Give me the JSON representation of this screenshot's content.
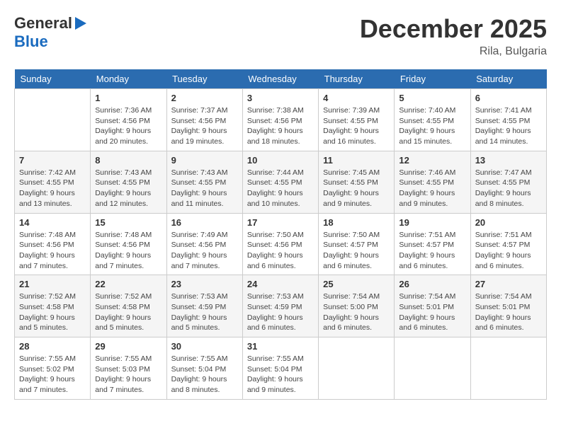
{
  "header": {
    "logo_line1": "General",
    "logo_line2": "Blue",
    "month_year": "December 2025",
    "location": "Rila, Bulgaria"
  },
  "days_of_week": [
    "Sunday",
    "Monday",
    "Tuesday",
    "Wednesday",
    "Thursday",
    "Friday",
    "Saturday"
  ],
  "weeks": [
    [
      {
        "day": "",
        "info": ""
      },
      {
        "day": "1",
        "info": "Sunrise: 7:36 AM\nSunset: 4:56 PM\nDaylight: 9 hours\nand 20 minutes."
      },
      {
        "day": "2",
        "info": "Sunrise: 7:37 AM\nSunset: 4:56 PM\nDaylight: 9 hours\nand 19 minutes."
      },
      {
        "day": "3",
        "info": "Sunrise: 7:38 AM\nSunset: 4:56 PM\nDaylight: 9 hours\nand 18 minutes."
      },
      {
        "day": "4",
        "info": "Sunrise: 7:39 AM\nSunset: 4:55 PM\nDaylight: 9 hours\nand 16 minutes."
      },
      {
        "day": "5",
        "info": "Sunrise: 7:40 AM\nSunset: 4:55 PM\nDaylight: 9 hours\nand 15 minutes."
      },
      {
        "day": "6",
        "info": "Sunrise: 7:41 AM\nSunset: 4:55 PM\nDaylight: 9 hours\nand 14 minutes."
      }
    ],
    [
      {
        "day": "7",
        "info": "Sunrise: 7:42 AM\nSunset: 4:55 PM\nDaylight: 9 hours\nand 13 minutes."
      },
      {
        "day": "8",
        "info": "Sunrise: 7:43 AM\nSunset: 4:55 PM\nDaylight: 9 hours\nand 12 minutes."
      },
      {
        "day": "9",
        "info": "Sunrise: 7:43 AM\nSunset: 4:55 PM\nDaylight: 9 hours\nand 11 minutes."
      },
      {
        "day": "10",
        "info": "Sunrise: 7:44 AM\nSunset: 4:55 PM\nDaylight: 9 hours\nand 10 minutes."
      },
      {
        "day": "11",
        "info": "Sunrise: 7:45 AM\nSunset: 4:55 PM\nDaylight: 9 hours\nand 9 minutes."
      },
      {
        "day": "12",
        "info": "Sunrise: 7:46 AM\nSunset: 4:55 PM\nDaylight: 9 hours\nand 9 minutes."
      },
      {
        "day": "13",
        "info": "Sunrise: 7:47 AM\nSunset: 4:55 PM\nDaylight: 9 hours\nand 8 minutes."
      }
    ],
    [
      {
        "day": "14",
        "info": "Sunrise: 7:48 AM\nSunset: 4:56 PM\nDaylight: 9 hours\nand 7 minutes."
      },
      {
        "day": "15",
        "info": "Sunrise: 7:48 AM\nSunset: 4:56 PM\nDaylight: 9 hours\nand 7 minutes."
      },
      {
        "day": "16",
        "info": "Sunrise: 7:49 AM\nSunset: 4:56 PM\nDaylight: 9 hours\nand 7 minutes."
      },
      {
        "day": "17",
        "info": "Sunrise: 7:50 AM\nSunset: 4:56 PM\nDaylight: 9 hours\nand 6 minutes."
      },
      {
        "day": "18",
        "info": "Sunrise: 7:50 AM\nSunset: 4:57 PM\nDaylight: 9 hours\nand 6 minutes."
      },
      {
        "day": "19",
        "info": "Sunrise: 7:51 AM\nSunset: 4:57 PM\nDaylight: 9 hours\nand 6 minutes."
      },
      {
        "day": "20",
        "info": "Sunrise: 7:51 AM\nSunset: 4:57 PM\nDaylight: 9 hours\nand 6 minutes."
      }
    ],
    [
      {
        "day": "21",
        "info": "Sunrise: 7:52 AM\nSunset: 4:58 PM\nDaylight: 9 hours\nand 5 minutes."
      },
      {
        "day": "22",
        "info": "Sunrise: 7:52 AM\nSunset: 4:58 PM\nDaylight: 9 hours\nand 5 minutes."
      },
      {
        "day": "23",
        "info": "Sunrise: 7:53 AM\nSunset: 4:59 PM\nDaylight: 9 hours\nand 5 minutes."
      },
      {
        "day": "24",
        "info": "Sunrise: 7:53 AM\nSunset: 4:59 PM\nDaylight: 9 hours\nand 6 minutes."
      },
      {
        "day": "25",
        "info": "Sunrise: 7:54 AM\nSunset: 5:00 PM\nDaylight: 9 hours\nand 6 minutes."
      },
      {
        "day": "26",
        "info": "Sunrise: 7:54 AM\nSunset: 5:01 PM\nDaylight: 9 hours\nand 6 minutes."
      },
      {
        "day": "27",
        "info": "Sunrise: 7:54 AM\nSunset: 5:01 PM\nDaylight: 9 hours\nand 6 minutes."
      }
    ],
    [
      {
        "day": "28",
        "info": "Sunrise: 7:55 AM\nSunset: 5:02 PM\nDaylight: 9 hours\nand 7 minutes."
      },
      {
        "day": "29",
        "info": "Sunrise: 7:55 AM\nSunset: 5:03 PM\nDaylight: 9 hours\nand 7 minutes."
      },
      {
        "day": "30",
        "info": "Sunrise: 7:55 AM\nSunset: 5:04 PM\nDaylight: 9 hours\nand 8 minutes."
      },
      {
        "day": "31",
        "info": "Sunrise: 7:55 AM\nSunset: 5:04 PM\nDaylight: 9 hours\nand 9 minutes."
      },
      {
        "day": "",
        "info": ""
      },
      {
        "day": "",
        "info": ""
      },
      {
        "day": "",
        "info": ""
      }
    ]
  ]
}
